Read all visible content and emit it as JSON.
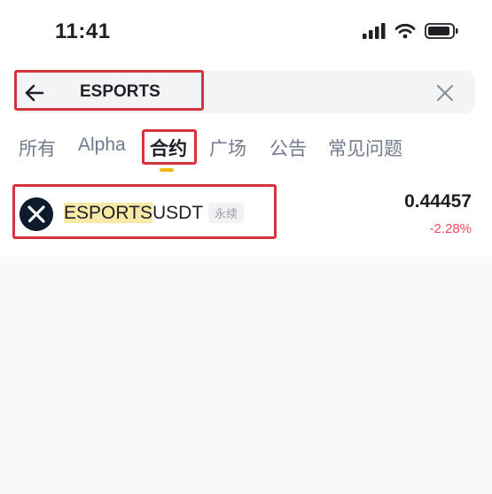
{
  "status_bar": {
    "time": "11:41",
    "icons": [
      "signal-icon",
      "wifi-icon",
      "battery-icon"
    ]
  },
  "search": {
    "value": "ESPORTS",
    "back_icon": "arrow-left-icon",
    "clear_icon": "close-icon"
  },
  "tabs": [
    {
      "label": "所有",
      "active": false
    },
    {
      "label": "Alpha",
      "active": false
    },
    {
      "label": "合约",
      "active": true
    },
    {
      "label": "广场",
      "active": false
    },
    {
      "label": "公告",
      "active": false
    },
    {
      "label": "常见问题",
      "active": false
    }
  ],
  "results": [
    {
      "symbol_match": "ESPORTS",
      "symbol_rest": "USDT",
      "badge": "永续",
      "price": "0.44457",
      "change": "-2.28%",
      "logo_icon": "esports-coin-logo-icon"
    }
  ],
  "colors": {
    "accent": "#f0b90b",
    "negative": "#f6465d",
    "highlight_box": "#d5343c",
    "match_highlight": "#f8e9a8"
  }
}
